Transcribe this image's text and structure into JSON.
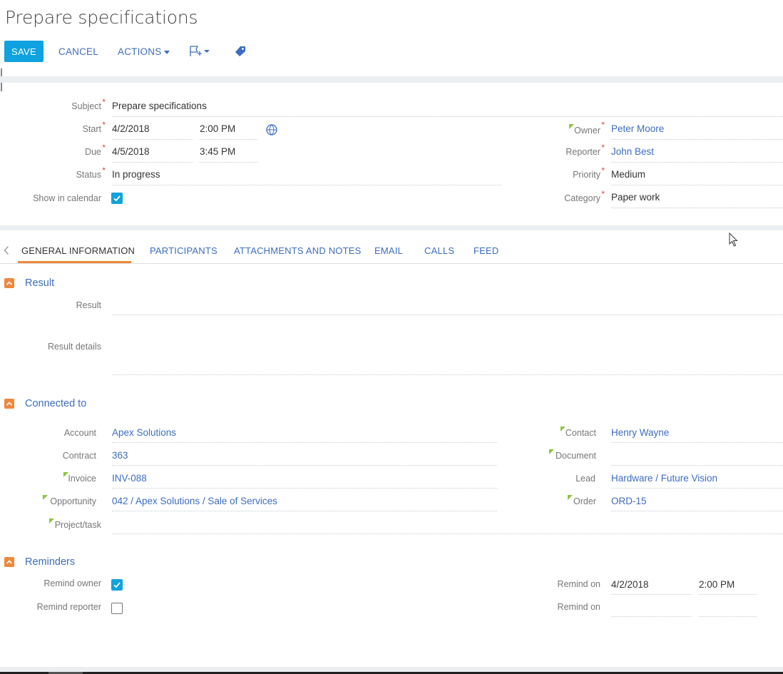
{
  "page": {
    "title": "Prepare specifications"
  },
  "toolbar": {
    "save": "SAVE",
    "cancel": "CANCEL",
    "actions": "ACTIONS"
  },
  "header": {
    "subject": {
      "label": "Subject",
      "value": "Prepare specifications"
    },
    "start": {
      "label": "Start",
      "date": "4/2/2018",
      "time": "2:00 PM"
    },
    "due": {
      "label": "Due",
      "date": "4/5/2018",
      "time": "3:45 PM"
    },
    "status": {
      "label": "Status",
      "value": "In progress"
    },
    "show_in_calendar": {
      "label": "Show in calendar",
      "checked": true
    },
    "owner": {
      "label": "Owner",
      "value": "Peter Moore"
    },
    "reporter": {
      "label": "Reporter",
      "value": "John Best"
    },
    "priority": {
      "label": "Priority",
      "value": "Medium"
    },
    "category": {
      "label": "Category",
      "value": "Paper work"
    }
  },
  "tabs": [
    {
      "label": "GENERAL INFORMATION",
      "active": true
    },
    {
      "label": "PARTICIPANTS"
    },
    {
      "label": "ATTACHMENTS AND NOTES"
    },
    {
      "label": "EMAIL"
    },
    {
      "label": "CALLS"
    },
    {
      "label": "FEED"
    }
  ],
  "result_section": {
    "title": "Result",
    "result": {
      "label": "Result",
      "value": ""
    },
    "result_details": {
      "label": "Result details",
      "value": ""
    }
  },
  "connected_section": {
    "title": "Connected to",
    "account": {
      "label": "Account",
      "value": "Apex Solutions"
    },
    "contract": {
      "label": "Contract",
      "value": "363"
    },
    "invoice": {
      "label": "Invoice",
      "value": "INV-088"
    },
    "opportunity": {
      "label": "Opportunity",
      "value": "042 / Apex Solutions / Sale of Services"
    },
    "project": {
      "label": "Project/task",
      "value": ""
    },
    "contact": {
      "label": "Contact",
      "value": "Henry Wayne"
    },
    "document": {
      "label": "Document",
      "value": ""
    },
    "lead": {
      "label": "Lead",
      "value": "Hardware / Future Vision"
    },
    "order": {
      "label": "Order",
      "value": "ORD-15"
    }
  },
  "reminders_section": {
    "title": "Reminders",
    "remind_owner": {
      "label": "Remind owner",
      "checked": true
    },
    "remind_reporter": {
      "label": "Remind reporter",
      "checked": false
    },
    "remind_on_owner": {
      "label": "Remind on",
      "date": "4/2/2018",
      "time": "2:00 PM"
    },
    "remind_on_reporter": {
      "label": "Remind on",
      "date": "",
      "time": ""
    }
  },
  "colors": {
    "accent": "#0ea2e0",
    "link": "#3d6dbf",
    "section_toggle": "#f0883c",
    "required": "#e04444",
    "marker": "#8ac63a"
  }
}
